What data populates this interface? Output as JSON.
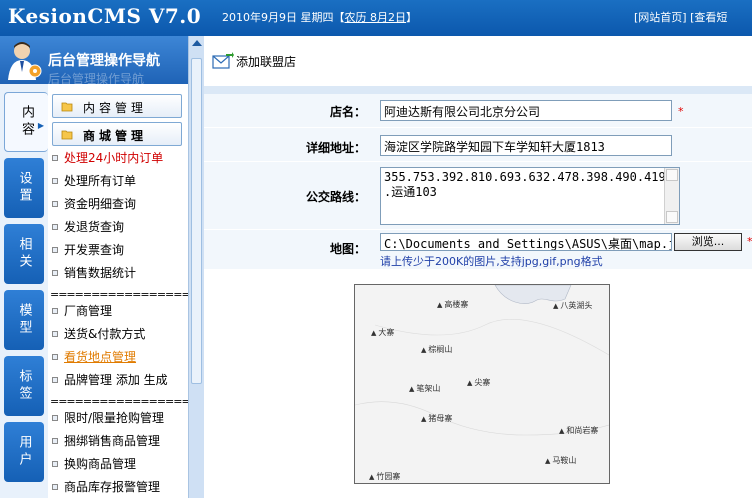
{
  "header": {
    "logo": "KesionCMS V7.0",
    "date_prefix": "2010年9月9日 星期四【",
    "lunar": "农历 8月2日",
    "date_suffix": "】",
    "links": "[网站首页] [查看短"
  },
  "sidebar": {
    "title": "后台管理操作导航",
    "title_ghost": "后台管理操作导航",
    "tabs": [
      {
        "label": "内容",
        "active": true
      },
      {
        "label": "设置"
      },
      {
        "label": "相关"
      },
      {
        "label": "模型"
      },
      {
        "label": "标签"
      },
      {
        "label": "用户"
      }
    ],
    "group_buttons": [
      "内容管理",
      "商城管理"
    ],
    "items_a": [
      "处理24小时内订单",
      "处理所有订单",
      "资金明细查询",
      "发退货查询",
      "开发票查询",
      "销售数据统计"
    ],
    "separator": "====================",
    "items_b": [
      "厂商管理",
      "送货&付款方式",
      "看货地点管理",
      "品牌管理 添加 生成"
    ],
    "items_c": [
      "限时/限量抢购管理",
      "捆绑销售商品管理",
      "换购商品管理",
      "商品库存报警管理"
    ]
  },
  "page": {
    "heading": "添加联盟店",
    "form": {
      "name_label": "店名：",
      "name_value": "阿迪达斯有限公司北京分公司",
      "address_label": "详细地址：",
      "address_value": "海淀区学院路学知园下车学知轩大厦1813",
      "bus_label": "公交路线：",
      "bus_line1": "355.753.392.810.693.632.478.398.490.419",
      "bus_line2": ".运通103",
      "map_label": "地图：",
      "map_value": "C:\\Documents and Settings\\ASUS\\桌面\\map.jpg",
      "browse_label": "浏览...",
      "hint": "请上传少于200K的图片,支持jpg,gif,png格式",
      "required_mark": "*"
    },
    "map_places": [
      "高楼寨",
      "八英湖头",
      "大寨",
      "棕榈山",
      "尖寨",
      "笔架山",
      "猪母寨",
      "和尚岩寨",
      "马鞍山",
      "竹园寨"
    ]
  }
}
